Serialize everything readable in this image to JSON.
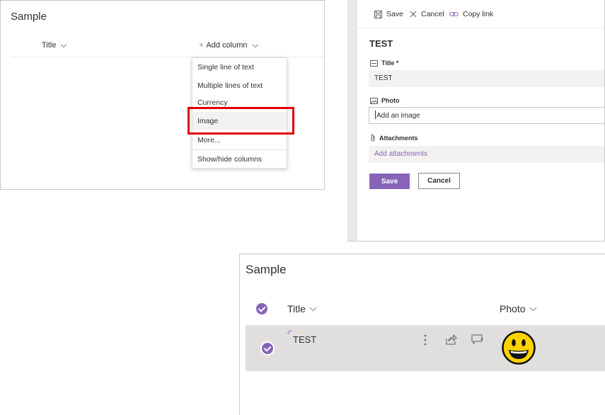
{
  "panel1": {
    "list_title": "Sample",
    "columns": {
      "title": "Title",
      "add_column": "Add column"
    },
    "menu_items": [
      "Single line of text",
      "Multiple lines of text",
      "Currency",
      "Image",
      "More...",
      "Show/hide columns"
    ],
    "selected_item": "Image",
    "highlight_color": "#e00000"
  },
  "panel2": {
    "commands": {
      "save": "Save",
      "cancel": "Cancel",
      "copy_link": "Copy link"
    },
    "form_title": "TEST",
    "fields": {
      "title_label": "Title",
      "title_required": "*",
      "title_value": "TEST",
      "photo_label": "Photo",
      "photo_placeholder": "Add an image",
      "attachments_label": "Attachments",
      "attachments_link": "Add attachments"
    },
    "buttons": {
      "save": "Save",
      "cancel": "Cancel"
    },
    "accent_color": "#8764b8"
  },
  "panel3": {
    "list_title": "Sample",
    "columns": {
      "title": "Title",
      "photo": "Photo"
    },
    "rows": [
      {
        "title": "TEST",
        "photo_icon": "grinning-face-emoji",
        "selected": true
      }
    ]
  }
}
